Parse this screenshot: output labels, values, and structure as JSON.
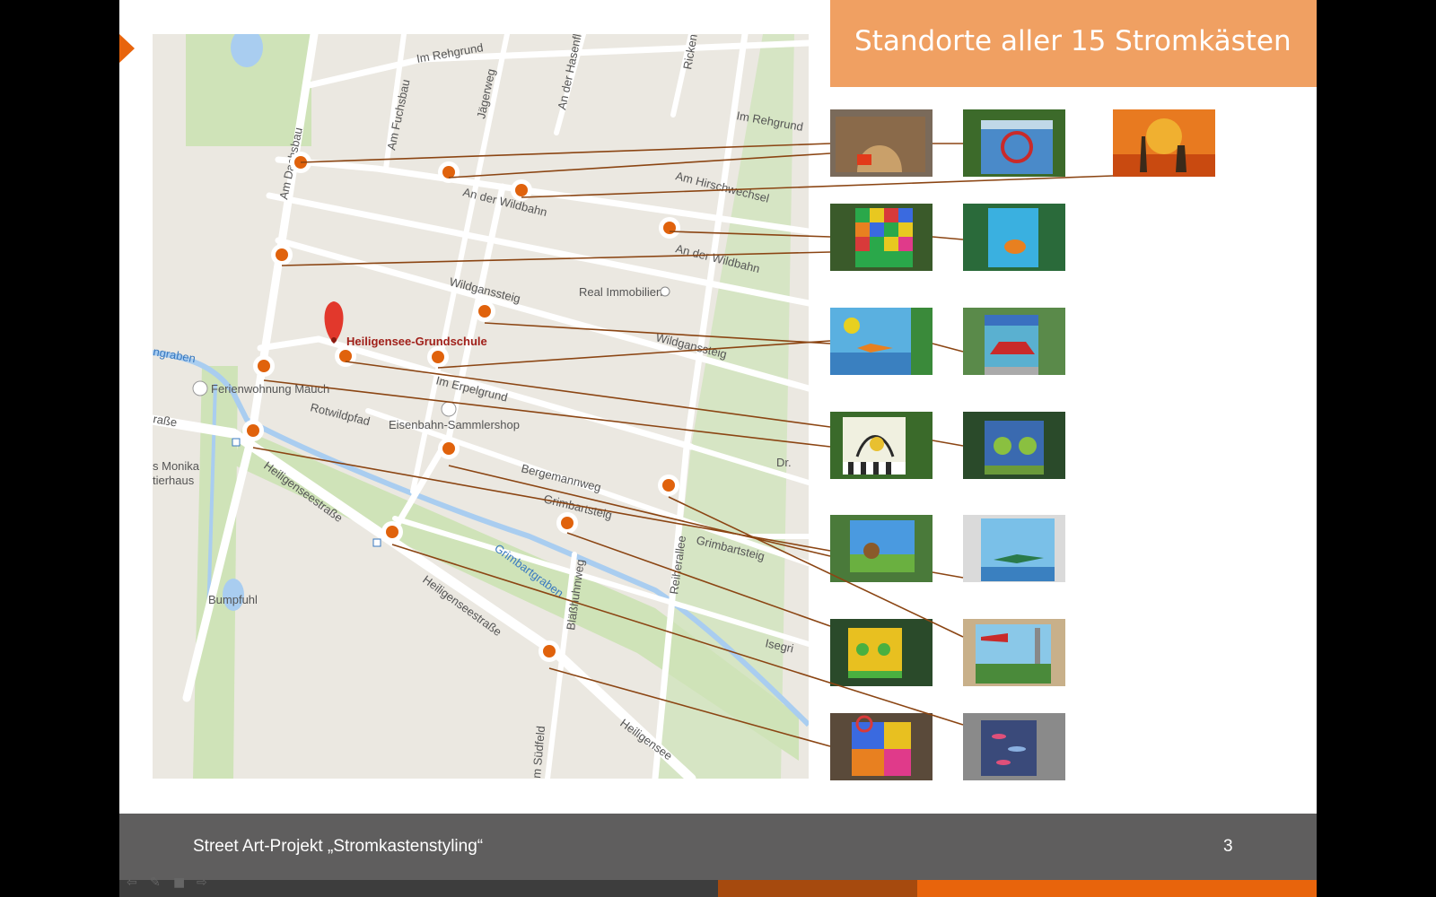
{
  "slide": {
    "title": "Standorte aller 15 Stromkästen",
    "footer_text": "Street Art-Projekt „Stromkastenstyling“",
    "page_number": "3"
  },
  "map": {
    "school_label": "Heiligensee-Grundschule",
    "labels": {
      "im_rehgrund_top": "Im Rehgrund",
      "im_rehgrund_right": "Im Rehgrund",
      "am_fuchsbau": "Am Fuchsbau",
      "jaegerweg": "Jägerweg",
      "an_der_hasenfl": "An der Hasenfl",
      "ricken": "Ricken",
      "am_dachsbau": "Am Dachsbau",
      "am_hirschwechsel": "Am Hirschwechsel",
      "an_der_wildbahn_1": "An der Wildbahn",
      "an_der_wildbahn_2": "An der Wildbahn",
      "wildganssteig_1": "Wildganssteig",
      "wildganssteig_2": "Wildganssteig",
      "real_immobilien": "Real Immobilien",
      "graben": "ngraben",
      "ferienwohnung": "Ferienwohnung Mauch",
      "im_erpelgrund": "Im Erpelgrund",
      "rotwildpfad": "Rotwildpfad",
      "eisenbahn": "Eisenbahn-Sammlershop",
      "strasse_left": "raße",
      "monika": "s Monika",
      "tierhaus": "tierhaus",
      "bergemannweg": "Bergemannweg",
      "grimbartsteig_1": "Grimbartsteig",
      "grimbartsteig_2": "Grimbartsteig",
      "dr": "Dr.",
      "heiligenseestrasse_1": "Heiligenseestraße",
      "heiligenseestrasse_2": "Heiligenseestraße",
      "heiligensee_bottom": "Heiligensee",
      "grimbartgraben": "Grimbartgraben",
      "blasshuhnweg": "Bläßhuhnweg",
      "reiherallee": "Reiherallee",
      "bumpfuhl": "Bumpfuhl",
      "isegrim": "Isegri",
      "am_suedfeld": "m Südfeld"
    }
  },
  "thumbnails": [
    {
      "id": "box-01",
      "theme": "brown-box",
      "colors": [
        "#8a6a4a",
        "#c9a06a",
        "#e23a1a"
      ]
    },
    {
      "id": "box-02",
      "theme": "bicycle-wheel",
      "colors": [
        "#4a8ac9",
        "#c0d8e8",
        "#3c6a2a"
      ]
    },
    {
      "id": "box-03",
      "theme": "rabbit-sunset",
      "colors": [
        "#e87a20",
        "#c94a10",
        "#3a2a1a"
      ]
    },
    {
      "id": "box-04",
      "theme": "colored-blocks",
      "colors": [
        "#2aa84a",
        "#e8c820",
        "#d83a3a"
      ]
    },
    {
      "id": "box-05",
      "theme": "fish",
      "colors": [
        "#3ab0e0",
        "#e88020",
        "#2a6a3a"
      ]
    },
    {
      "id": "box-06",
      "theme": "sun-water",
      "colors": [
        "#5ab0e0",
        "#e8d020",
        "#3a8a3a"
      ]
    },
    {
      "id": "box-07",
      "theme": "red-car",
      "colors": [
        "#5ab0d0",
        "#c92a2a",
        "#5a8a4a"
      ]
    },
    {
      "id": "box-08",
      "theme": "piano-cat",
      "colors": [
        "#f0f0e0",
        "#e8c030",
        "#2a2a2a"
      ]
    },
    {
      "id": "box-09",
      "theme": "trees",
      "colors": [
        "#3a6ab0",
        "#8ac040",
        "#2a4a2a"
      ]
    },
    {
      "id": "box-10",
      "theme": "owl-meadow",
      "colors": [
        "#4a9ae0",
        "#6ab040",
        "#8a5a2a"
      ]
    },
    {
      "id": "box-11",
      "theme": "crocodile",
      "colors": [
        "#7ac0e8",
        "#2a7a4a",
        "#dadada"
      ]
    },
    {
      "id": "box-12",
      "theme": "yellow-figures",
      "colors": [
        "#e8c020",
        "#4ab040",
        "#2a4a2a"
      ]
    },
    {
      "id": "box-13",
      "theme": "airplane-tower",
      "colors": [
        "#8ac8e8",
        "#c92a2a",
        "#4a8a3a"
      ]
    },
    {
      "id": "box-14",
      "theme": "horseshoe-colors",
      "colors": [
        "#e8c020",
        "#3a6ae0",
        "#e03a8a"
      ]
    },
    {
      "id": "box-15",
      "theme": "fish-night",
      "colors": [
        "#3a4a7a",
        "#8ab0e0",
        "#e0507a"
      ]
    }
  ],
  "colors": {
    "accent": "#e8640c",
    "title_bg": "#f0a062",
    "footer_bg": "#5f5e5e",
    "connector": "#8b4513",
    "marker": "#e0620c"
  },
  "icons": {
    "school_pin": "map-pin-icon",
    "real_estate": "shop-icon",
    "hotel": "bed-icon",
    "shop": "shopping-bag-icon",
    "bus": "bus-stop-icon",
    "nav_prev": "arrow-left-icon",
    "nav_pen": "pen-icon",
    "nav_menu": "menu-icon",
    "nav_next": "arrow-right-icon"
  }
}
